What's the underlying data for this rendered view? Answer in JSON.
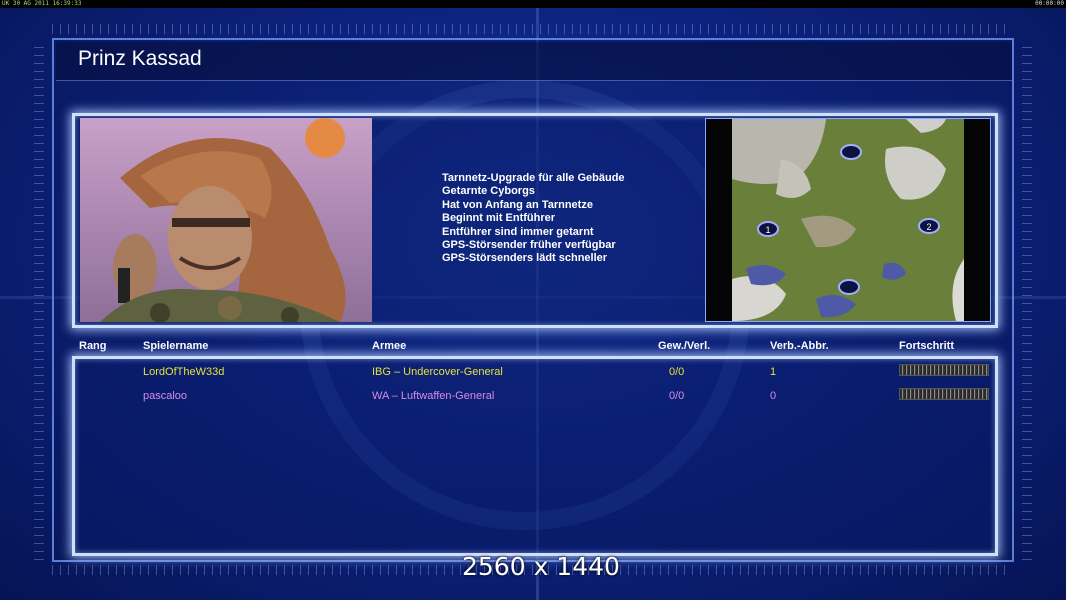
{
  "topbar": {
    "left_text": "UK 30 AG 2011 16:39:33",
    "right_text": "00:00:00"
  },
  "title": "Prinz Kassad",
  "general_traits": [
    "Tarnnetz-Upgrade für alle Gebäude",
    "Getarnte Cyborgs",
    "Hat von Anfang an Tarnnetze",
    "Beginnt mit Entführer",
    "Entführer sind immer getarnt",
    "GPS-Störsender früher verfügbar",
    "GPS-Störsenders lädt schneller"
  ],
  "map": {
    "start_positions": [
      "1",
      "2"
    ]
  },
  "table": {
    "headers": {
      "rank": "Rang",
      "player": "Spielername",
      "army": "Armee",
      "win_loss": "Gew./Verl.",
      "conn": "Verb.-Abbr.",
      "progress": "Fortschritt"
    },
    "rows": [
      {
        "rank": "",
        "player": "LordOfTheW33d",
        "army": "IBG – Undercover-General",
        "win_loss": "0/0",
        "conn": "1",
        "color": "#e6e23a"
      },
      {
        "rank": "",
        "player": "pascaloo",
        "army": "WA – Luftwaffen-General",
        "win_loss": "0/0",
        "conn": "0",
        "color": "#d68ce8"
      }
    ]
  },
  "overlay_text": "2560 x 1440"
}
